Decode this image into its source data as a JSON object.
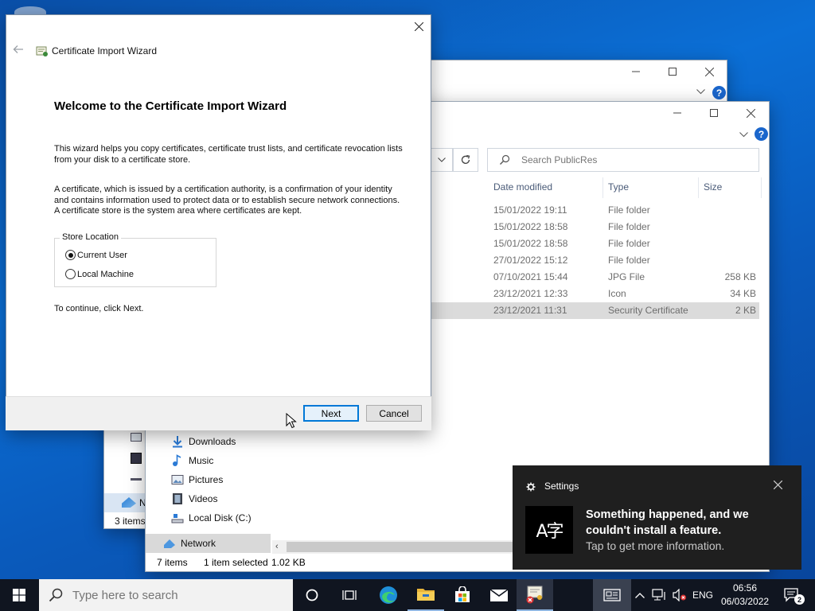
{
  "back_explorer": {},
  "explorer": {
    "search": {
      "placeholder": "Search PublicRes"
    },
    "columns": {
      "date": "Date modified",
      "type": "Type",
      "size": "Size"
    },
    "rows": [
      {
        "date": "15/01/2022 19:11",
        "type": "File folder",
        "size": ""
      },
      {
        "date": "15/01/2022 18:58",
        "type": "File folder",
        "size": ""
      },
      {
        "date": "15/01/2022 18:58",
        "type": "File folder",
        "size": ""
      },
      {
        "date": "27/01/2022 15:12",
        "type": "File folder",
        "size": ""
      },
      {
        "date": "07/10/2021 15:44",
        "type": "JPG File",
        "size": "258 KB"
      },
      {
        "date": "23/12/2021 12:33",
        "type": "Icon",
        "size": "34 KB"
      },
      {
        "date": "23/12/2021 11:31",
        "type": "Security Certificate",
        "size": "2 KB"
      }
    ],
    "nav": [
      {
        "label": "Downloads",
        "icon": "download-icon"
      },
      {
        "label": "Music",
        "icon": "music-icon"
      },
      {
        "label": "Pictures",
        "icon": "pictures-icon"
      },
      {
        "label": "Videos",
        "icon": "videos-icon"
      },
      {
        "label": "Local Disk (C:)",
        "icon": "drive-icon"
      },
      {
        "label": "Network",
        "icon": "network-icon"
      }
    ],
    "status": {
      "items": "7 items",
      "selected": "1 item selected",
      "size": "1.02 KB"
    },
    "back_status_items": "3 items",
    "back_nav_partial": "N"
  },
  "wizard": {
    "title_bar": "Certificate Import Wizard",
    "heading": "Welcome to the Certificate Import Wizard",
    "para1": "This wizard helps you copy certificates, certificate trust lists, and certificate revocation lists from your disk to a certificate store.",
    "para2": "A certificate, which is issued by a certification authority, is a confirmation of your identity and contains information used to protect data or to establish secure network connections. A certificate store is the system area where certificates are kept.",
    "store_location": {
      "legend": "Store Location",
      "options": [
        {
          "label": "Current User",
          "selected": true
        },
        {
          "label": "Local Machine",
          "selected": false
        }
      ]
    },
    "continue_text": "To continue, click Next.",
    "next_label": "Next",
    "cancel_label": "Cancel"
  },
  "toast": {
    "app": "Settings",
    "title": "Something happened, and we couldn't install a feature.",
    "body": "Tap to get more information.",
    "icon_glyph": "A字"
  },
  "taskbar": {
    "search_placeholder": "Type here to search",
    "language": "ENG",
    "time": "06:56",
    "date": "06/03/2022",
    "notification_count": "2"
  },
  "colors": {
    "accent": "#0078d7",
    "toast_bg": "#1f1f1f",
    "taskbar_bg": "#101520",
    "selected_row": "#dbdbdb"
  }
}
